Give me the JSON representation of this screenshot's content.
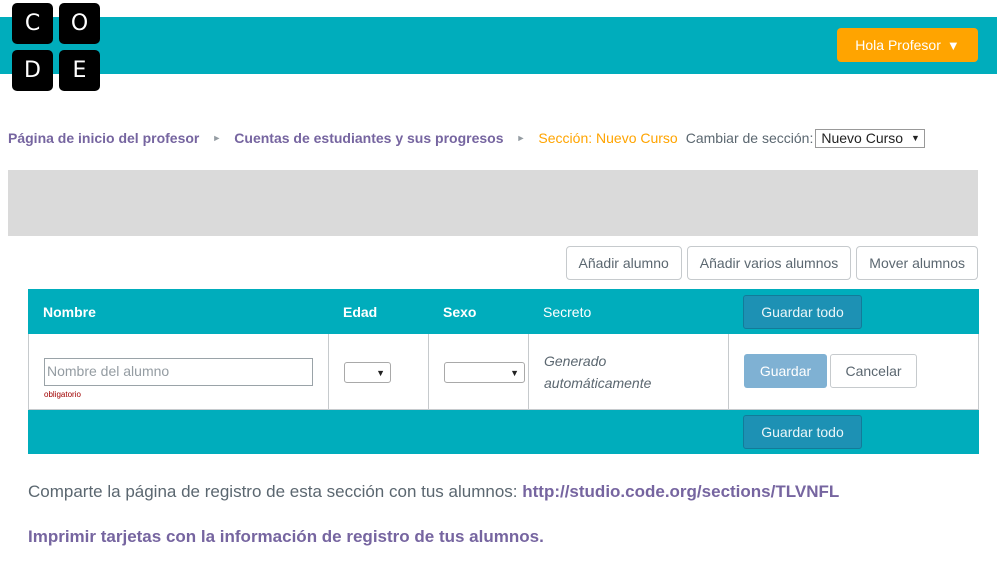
{
  "logo": {
    "letters": [
      "C",
      "O",
      "D",
      "E"
    ]
  },
  "header": {
    "user_button_label": "Hola Profesor",
    "user_button_caret": "▼"
  },
  "breadcrumb": {
    "items": [
      "Página de inicio del profesor",
      "Cuentas de estudiantes y sus progresos"
    ],
    "separator": "►",
    "current": "Sección: Nuevo Curso",
    "change_label": "Cambiar de sección:",
    "section_select_value": "Nuevo Curso"
  },
  "actions": {
    "add_student": "Añadir alumno",
    "add_multiple": "Añadir varios alumnos",
    "move_students": "Mover alumnos"
  },
  "table": {
    "columns": [
      "Nombre",
      "Edad",
      "Sexo",
      "Secreto"
    ],
    "save_all_label": "Guardar todo",
    "new_row": {
      "name_placeholder": "Nombre del alumno",
      "required_hint": "obligatorio",
      "age_value": "",
      "gender_value": "",
      "secret_text_line1": "Generado",
      "secret_text_line2": "automáticamente",
      "save_label": "Guardar",
      "cancel_label": "Cancelar"
    }
  },
  "footer": {
    "share_text": "Comparte la página de registro de esta sección con tus alumnos:",
    "share_url": "http://studio.code.org/sections/TLVNFL",
    "print_cards_link": "Imprimir tarjetas con la información de registro de tus alumnos."
  },
  "colors": {
    "teal": "#00adbc",
    "orange": "#ffa400",
    "purple": "#7665a0",
    "gray_bar": "#dadada"
  }
}
